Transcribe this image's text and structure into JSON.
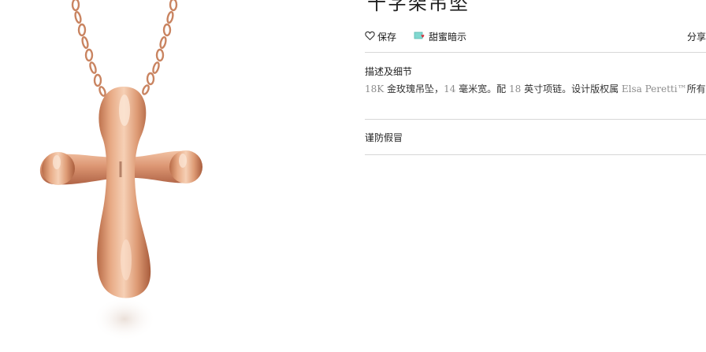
{
  "product": {
    "title_fragment": "十字架吊坠"
  },
  "actions": {
    "save_label": "保存",
    "hint_label": "甜蜜暗示",
    "share_label": "分享"
  },
  "details": {
    "section_title": "描述及细节",
    "desc_n1": "18K",
    "desc_t1": " 金玫瑰吊坠，",
    "desc_n2": "14",
    "desc_t2": " 毫米宽。配 ",
    "desc_n3": "18",
    "desc_t3": " 英寸项链。设计版权属 ",
    "desc_brand": "Elsa Peretti™",
    "desc_t4": "所有。"
  },
  "counterfeit": {
    "label": "谨防假冒"
  },
  "colors": {
    "rose_gold": "#d99b78",
    "rule": "#d7d7d7",
    "muted_text": "#8c8c8c"
  }
}
